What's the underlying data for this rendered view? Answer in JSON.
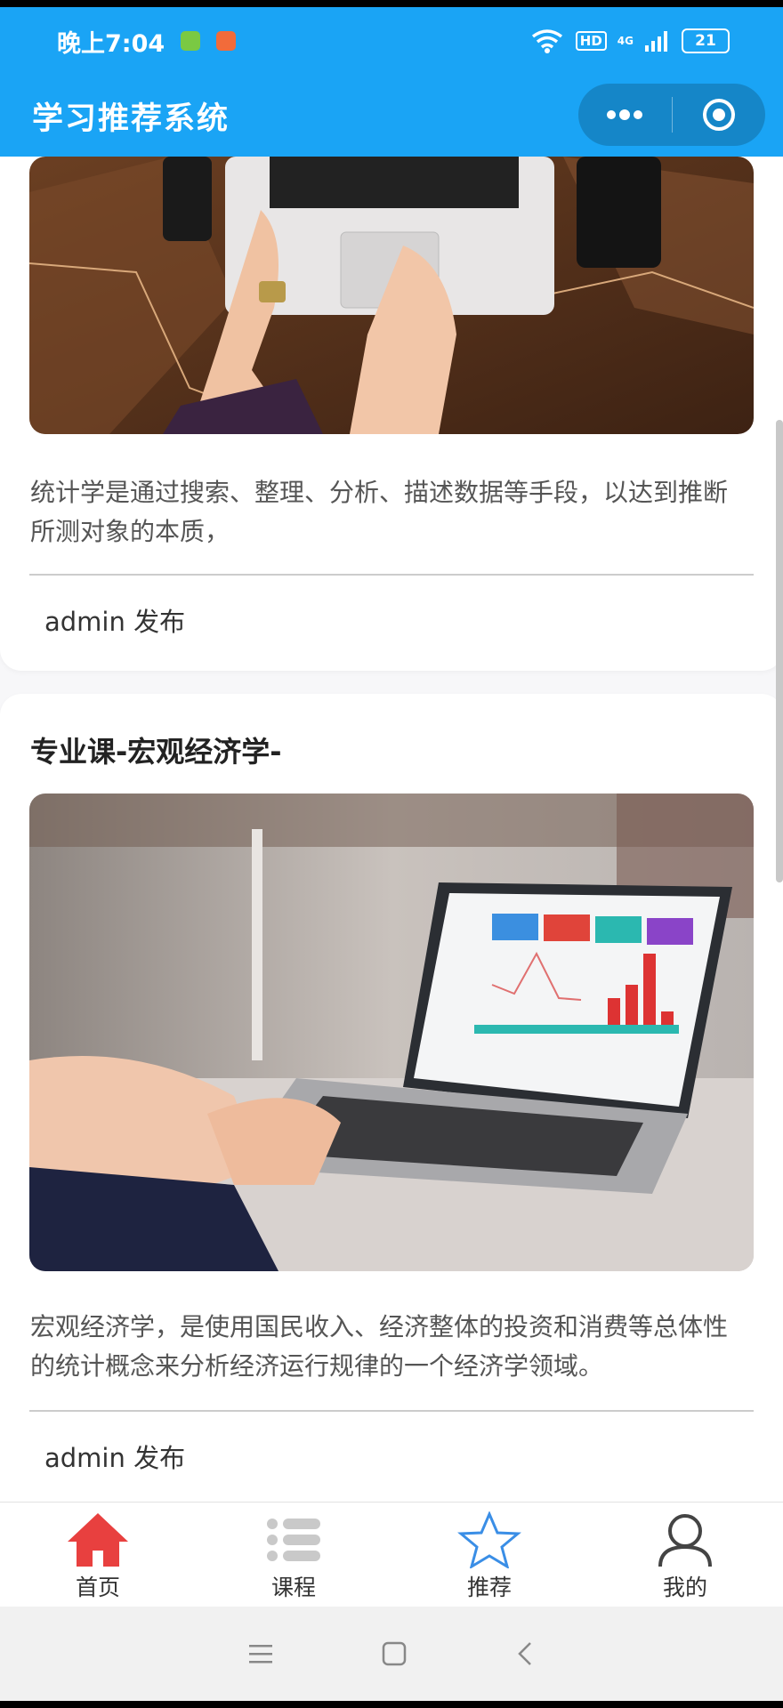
{
  "status_bar": {
    "time": "晚上7:04",
    "network": "4G",
    "hd": "HD",
    "battery": "21"
  },
  "navbar": {
    "title": "学习推荐系统"
  },
  "cards": [
    {
      "title": "",
      "description": "统计学是通过搜索、整理、分析、描述数据等手段，以达到推断所测对象的本质，",
      "author_line": "admin 发布"
    },
    {
      "title": "专业课-宏观经济学-",
      "description": "宏观经济学，是使用国民收入、经济整体的投资和消费等总体性的统计概念来分析经济运行规律的一个经济学领域。",
      "author_line": "admin 发布"
    }
  ],
  "tabbar": {
    "items": [
      {
        "label": "首页",
        "icon": "home-icon",
        "active": true
      },
      {
        "label": "课程",
        "icon": "list-icon"
      },
      {
        "label": "推荐",
        "icon": "star-icon"
      },
      {
        "label": "我的",
        "icon": "user-icon"
      }
    ]
  },
  "colors": {
    "primary": "#1aa4f5",
    "home_active": "#e8403f",
    "star_blue": "#3a8ee6"
  }
}
